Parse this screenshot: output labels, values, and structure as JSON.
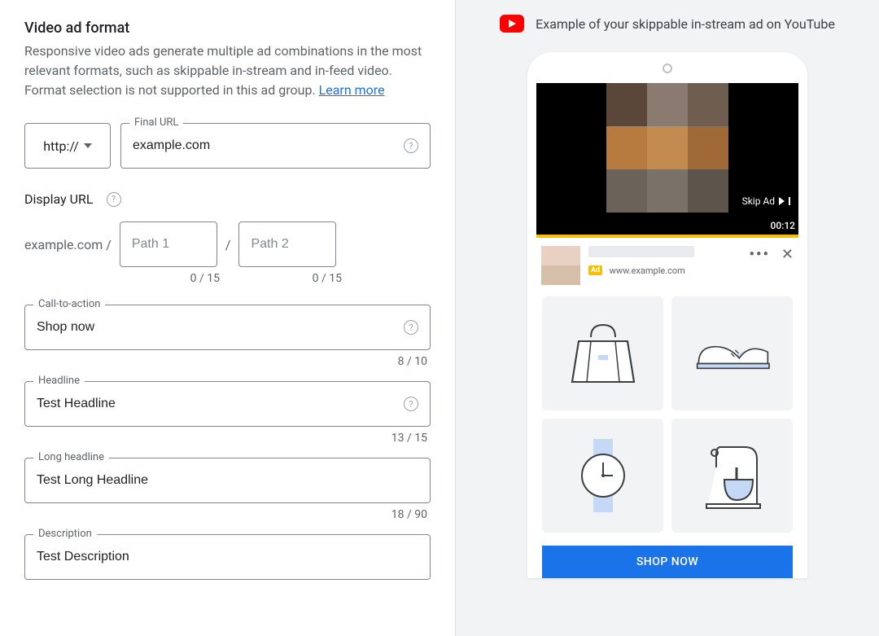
{
  "left": {
    "title": "Video ad format",
    "description": "Responsive video ads generate multiple ad combinations in the most relevant formats, such as skippable in-stream and in-feed video. Format selection is not supported in this ad group. ",
    "learn_more": "Learn more",
    "protocol": "http://",
    "final_url_label": "Final URL",
    "final_url_value": "example.com",
    "display_url_title": "Display URL",
    "display_domain": "example.com /",
    "path1_placeholder": "Path 1",
    "path_sep": "/",
    "path2_placeholder": "Path 2",
    "path1_counter": "0 / 15",
    "path2_counter": "0 / 15",
    "cta_label": "Call-to-action",
    "cta_value": "Shop now",
    "cta_counter": "8 / 10",
    "headline_label": "Headline",
    "headline_value": "Test Headline",
    "headline_counter": "13 / 15",
    "long_headline_label": "Long headline",
    "long_headline_value": "Test Long Headline",
    "long_headline_counter": "18 / 90",
    "description_label": "Description",
    "description_value": "Test Description"
  },
  "preview": {
    "header": "Example of your skippable in-stream ad on YouTube",
    "skip_label": "Skip Ad",
    "timer": "00:12",
    "ad_badge": "Ad",
    "ad_url": "www.example.com",
    "cta_button": "SHOP NOW"
  }
}
